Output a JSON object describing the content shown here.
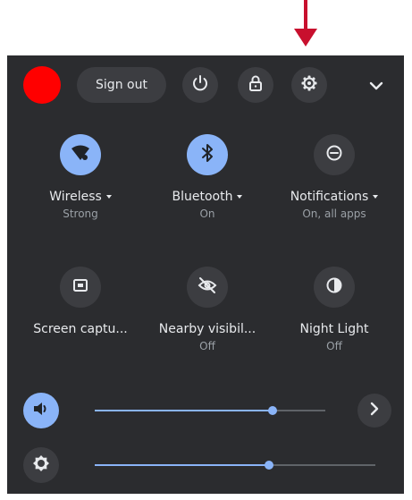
{
  "header": {
    "signout_label": "Sign out",
    "icons": [
      "power-icon",
      "lock-icon",
      "settings-gear-icon",
      "chevron-down-icon"
    ]
  },
  "tiles": [
    {
      "label": "Wireless",
      "sub": "Strong",
      "icon": "wifi-icon",
      "active": true,
      "has_menu": true
    },
    {
      "label": "Bluetooth",
      "sub": "On",
      "icon": "bluetooth-icon",
      "active": true,
      "has_menu": true
    },
    {
      "label": "Notifications",
      "sub": "On, all apps",
      "icon": "do-not-disturb-icon",
      "active": false,
      "has_menu": true
    },
    {
      "label": "Screen captu...",
      "sub": "",
      "icon": "screen-capture-icon",
      "active": false,
      "has_menu": false
    },
    {
      "label": "Nearby visibil...",
      "sub": "Off",
      "icon": "nearby-visibility-off-icon",
      "active": false,
      "has_menu": false
    },
    {
      "label": "Night Light",
      "sub": "Off",
      "icon": "night-light-icon",
      "active": false,
      "has_menu": false
    }
  ],
  "sliders": {
    "volume": {
      "icon": "volume-icon",
      "level": 0.77
    },
    "brightness": {
      "icon": "brightness-icon",
      "level": 0.62
    }
  },
  "colors": {
    "panel": "#2b2c2f",
    "accent": "#8ab4f8",
    "avatar": "#ff0000",
    "annotation_arrow": "#c8102e"
  }
}
